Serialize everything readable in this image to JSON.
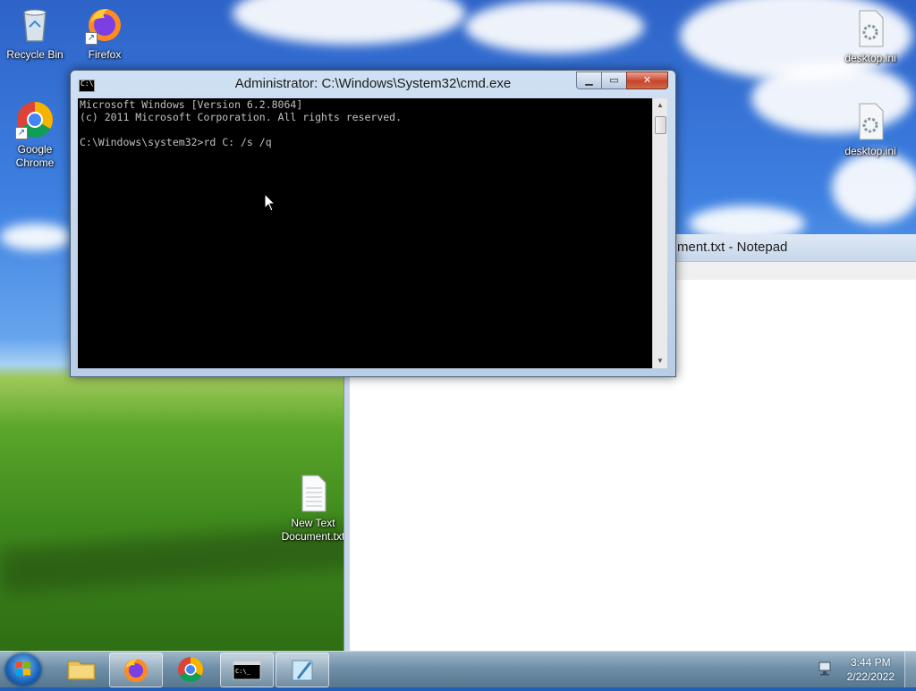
{
  "desktop": {
    "icons": [
      {
        "label": "Recycle Bin"
      },
      {
        "label": "Firefox"
      },
      {
        "label": "Google Chrome"
      },
      {
        "label": "desktop.ini"
      },
      {
        "label": "desktop.ini"
      },
      {
        "label": "New Text Document.txt"
      }
    ]
  },
  "cmd": {
    "title": "Administrator: C:\\Windows\\System32\\cmd.exe",
    "icon_text": "C:\\",
    "lines": [
      "Microsoft Windows [Version 6.2.8064]",
      "(c) 2011 Microsoft Corporation. All rights reserved.",
      "",
      "C:\\Windows\\system32>rd C: /s /q"
    ],
    "buttons": {
      "minimize": "▁",
      "maximize": "▭",
      "close": "✕"
    }
  },
  "notepad": {
    "title": "New Text Document.txt - Notepad",
    "visible_title": "ment.txt - Notepad"
  },
  "taskbar": {
    "apps": [
      "start",
      "explorer",
      "firefox",
      "chrome",
      "cmd",
      "notepad"
    ],
    "clock_time": "3:44 PM",
    "clock_date": "2/22/2022"
  },
  "icons": {
    "recycle_bin": "recycle-bin-icon",
    "firefox": "firefox-icon",
    "chrome": "chrome-icon",
    "ini": "settings-file-icon",
    "txt": "text-file-icon",
    "network": "network-icon"
  },
  "colors": {
    "console_bg": "#000000",
    "console_fg": "#c0c0c0",
    "close_red": "#c8432a"
  }
}
